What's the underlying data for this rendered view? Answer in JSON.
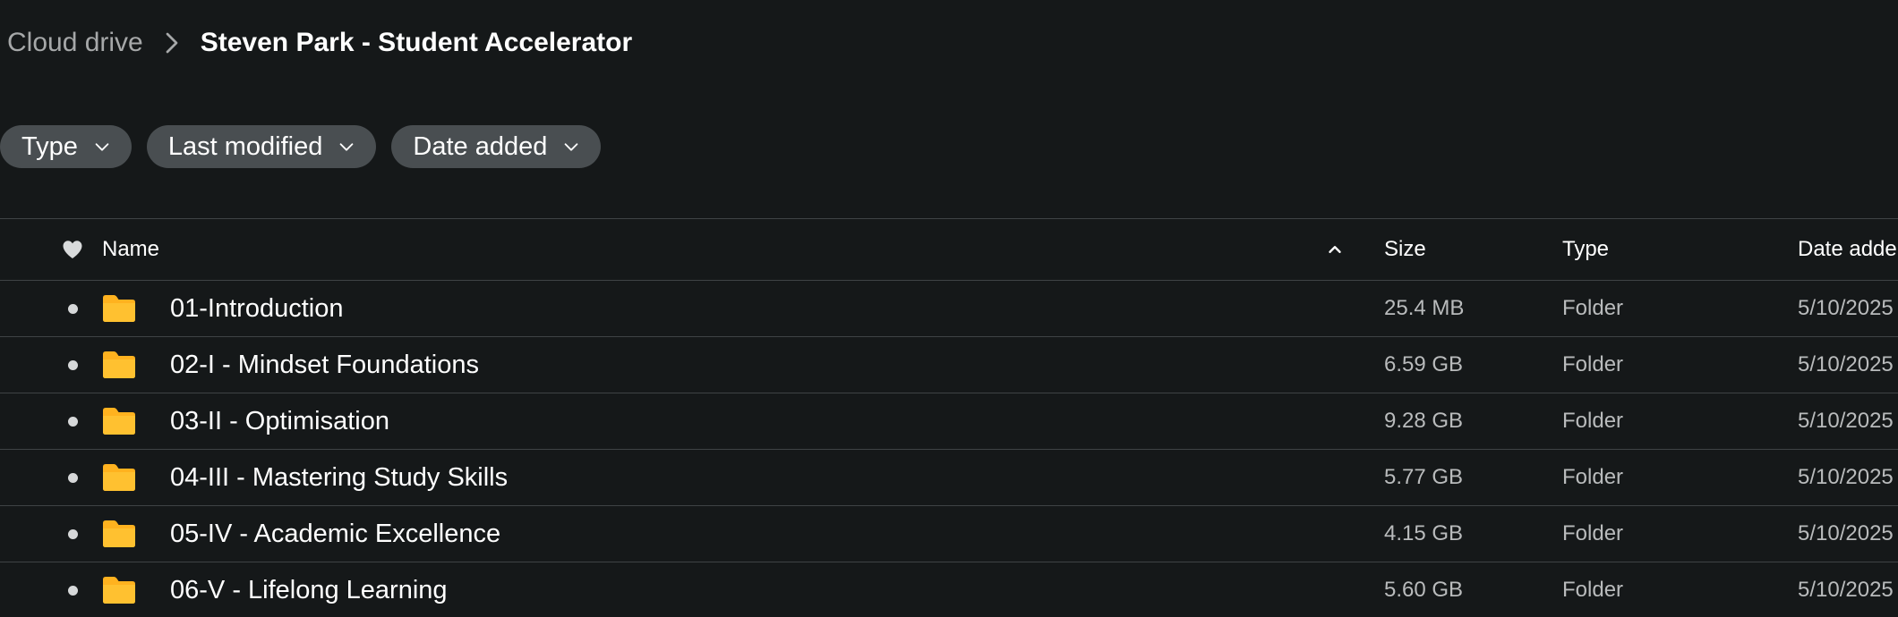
{
  "breadcrumb": {
    "root": "Cloud drive",
    "current": "Steven Park - Student Accelerator"
  },
  "filters": [
    {
      "label": "Type"
    },
    {
      "label": "Last modified"
    },
    {
      "label": "Date added"
    }
  ],
  "table": {
    "columns": {
      "name": "Name",
      "size": "Size",
      "type": "Type",
      "date_added": "Date adde"
    },
    "rows": [
      {
        "name": "01-Introduction",
        "size": "25.4 MB",
        "type": "Folder",
        "date_added": "5/10/2025"
      },
      {
        "name": "02-I - Mindset Foundations",
        "size": "6.59 GB",
        "type": "Folder",
        "date_added": "5/10/2025"
      },
      {
        "name": "03-II - Optimisation",
        "size": "9.28 GB",
        "type": "Folder",
        "date_added": "5/10/2025"
      },
      {
        "name": "04-III - Mastering Study Skills",
        "size": "5.77 GB",
        "type": "Folder",
        "date_added": "5/10/2025"
      },
      {
        "name": "05-IV - Academic Excellence",
        "size": "4.15 GB",
        "type": "Folder",
        "date_added": "5/10/2025"
      },
      {
        "name": "06-V - Lifelong Learning",
        "size": "5.60 GB",
        "type": "Folder",
        "date_added": "5/10/2025"
      }
    ]
  },
  "colors": {
    "background": "#151819",
    "chip": "#494e51",
    "folder": "#ffb21f",
    "divider": "#3f4345"
  },
  "icons": {
    "favorite": "heart-icon",
    "sort": "chevron-up-icon",
    "filter_dropdown": "chevron-down-icon",
    "breadcrumb_separator": "chevron-right-icon",
    "row_folder": "folder-icon"
  }
}
